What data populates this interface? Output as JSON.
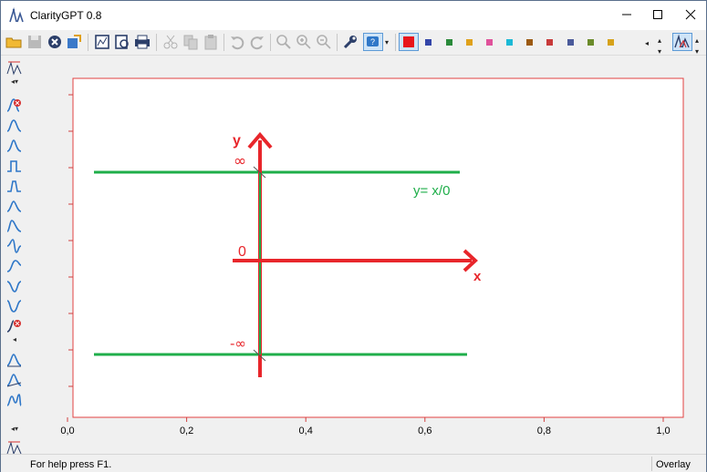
{
  "window": {
    "title": "ClarityGPT 0.8"
  },
  "toolbar": {
    "buttons": [
      "open-folder-icon",
      "save-icon",
      "close-doc-icon",
      "export-icon",
      "chart-view-icon",
      "print-preview-icon",
      "print-icon",
      "cut-icon",
      "copy-icon",
      "paste-icon",
      "undo-icon",
      "redo-icon",
      "zoom-fit-icon",
      "zoom-in-icon",
      "zoom-out-icon",
      "settings-wrench-icon",
      "help-icon"
    ],
    "active_color": "#e8151b",
    "palette": [
      "#3345a8",
      "#2a8a3a",
      "#e0a11b",
      "#e0529b",
      "#1bb9d6",
      "#9c5a12",
      "#c83a3a",
      "#4a5a9a",
      "#6b8b2a",
      "#d6a21a"
    ]
  },
  "chart": {
    "x_tick_labels": [
      "0,0",
      "0,2",
      "0,4",
      "0,6",
      "0,8",
      "1,0"
    ],
    "annotations": {
      "y_axis": "y",
      "x_axis": "x",
      "infinity": "∞",
      "neg_infinity": "-∞",
      "zero": "0",
      "equation": "y= x/0"
    },
    "colors": {
      "axis_arrow": "#e8262b",
      "lines": "#1fae4a",
      "frame": "#e24040"
    }
  },
  "status": {
    "help": "For help press F1.",
    "mode": "Overlay"
  }
}
